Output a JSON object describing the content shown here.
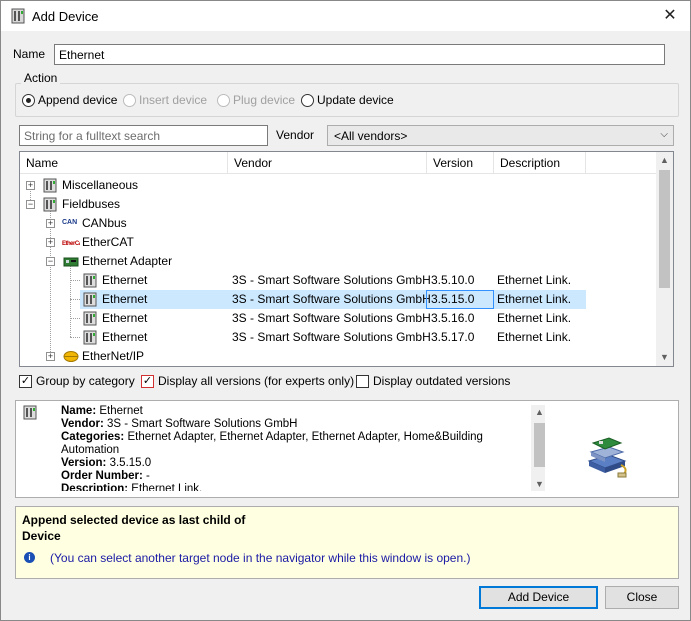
{
  "window": {
    "title": "Add Device",
    "close_glyph": "✕"
  },
  "name_field": {
    "label": "Name",
    "value": "Ethernet"
  },
  "action": {
    "legend": "Action",
    "options": [
      {
        "label": "Append device",
        "checked": true,
        "enabled": true
      },
      {
        "label": "Insert device",
        "checked": false,
        "enabled": false
      },
      {
        "label": "Plug device",
        "checked": false,
        "enabled": false
      },
      {
        "label": "Update device",
        "checked": false,
        "enabled": true
      }
    ]
  },
  "search": {
    "placeholder": "String for a fulltext search",
    "vendor_label": "Vendor",
    "vendor_value": "<All vendors>"
  },
  "table": {
    "headers": {
      "name": "Name",
      "vendor": "Vendor",
      "version": "Version",
      "description": "Description"
    },
    "rows": [
      {
        "name": "Miscellaneous",
        "expand": "+",
        "icon": "device-icon"
      },
      {
        "name": "Fieldbuses",
        "expand": "−",
        "icon": "device-icon"
      },
      {
        "name": "CANbus",
        "expand": "+",
        "icon": "canbus-icon",
        "icon_text": "CAN"
      },
      {
        "name": "EtherCAT",
        "expand": "+",
        "icon": "ethercat-icon",
        "icon_text": "EtherCAT"
      },
      {
        "name": "Ethernet Adapter",
        "expand": "−",
        "icon": "ethernet-adapter-icon"
      },
      {
        "name": "Ethernet",
        "vendor": "3S - Smart Software Solutions GmbH",
        "version": "3.5.10.0",
        "description": "Ethernet Link."
      },
      {
        "name": "Ethernet",
        "vendor": "3S - Smart Software Solutions GmbH",
        "version": "3.5.15.0",
        "description": "Ethernet Link.",
        "selected": true
      },
      {
        "name": "Ethernet",
        "vendor": "3S - Smart Software Solutions GmbH",
        "version": "3.5.16.0",
        "description": "Ethernet Link."
      },
      {
        "name": "Ethernet",
        "vendor": "3S - Smart Software Solutions GmbH",
        "version": "3.5.17.0",
        "description": "Ethernet Link."
      },
      {
        "name": "EtherNet/IP",
        "expand": "+",
        "icon": "ethernetip-icon"
      }
    ]
  },
  "options": {
    "group_by_category": {
      "label": "Group by category",
      "checked": true
    },
    "display_all_versions": {
      "label": "Display all versions (for experts only)",
      "checked": true
    },
    "display_outdated": {
      "label": "Display outdated versions",
      "checked": false
    }
  },
  "info": {
    "name_label": "Name:",
    "name_value": "Ethernet",
    "vendor_label": "Vendor:",
    "vendor_value": "3S - Smart Software Solutions GmbH",
    "categories_label": "Categories:",
    "categories_value": "Ethernet Adapter, Ethernet Adapter, Ethernet Adapter, Home&Building Automation",
    "version_label": "Version:",
    "version_value": "3.5.15.0",
    "order_label": "Order Number:",
    "order_value": "-",
    "description_label": "Description:",
    "description_value": "Ethernet Link."
  },
  "notice": {
    "line1": "Append selected device as last child of",
    "line2": "Device",
    "hint": "(You can select another target node in the navigator while this window is open.)",
    "hint_icon": "i"
  },
  "buttons": {
    "add": "Add Device",
    "close": "Close"
  },
  "colors": {
    "selection": "#cce8ff",
    "hint_text": "#1a1aa6",
    "notice_bg": "#ffffe1",
    "accent": "#0078d7"
  }
}
